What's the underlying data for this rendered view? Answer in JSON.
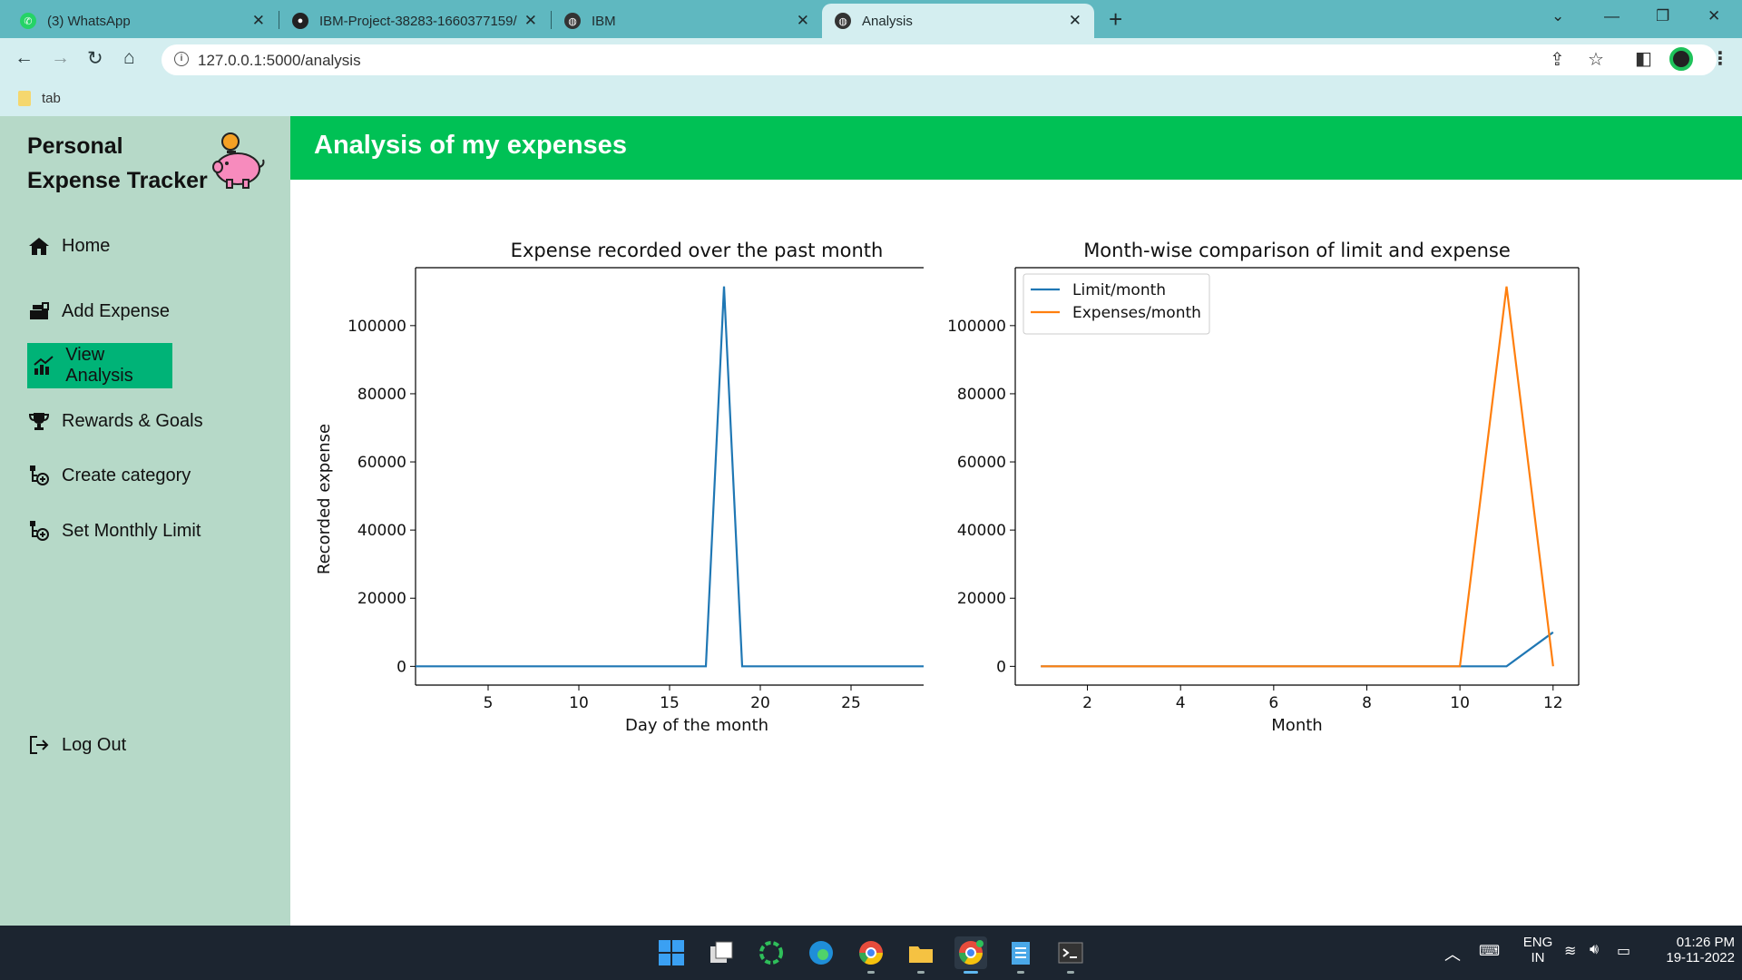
{
  "browser": {
    "tabs": [
      {
        "title": "(3) WhatsApp",
        "icon": "whatsapp-icon",
        "active": false
      },
      {
        "title": "IBM-Project-38283-1660377159/",
        "icon": "github-icon",
        "active": false
      },
      {
        "title": "IBM",
        "icon": "globe-icon",
        "active": false
      },
      {
        "title": "Analysis",
        "icon": "globe-icon",
        "active": true
      }
    ],
    "url": "127.0.0.1:5000/analysis",
    "bookmarks": [
      {
        "label": "tab"
      }
    ]
  },
  "sidebar": {
    "brand_line1": "Personal",
    "brand_line2": "Expense Tracker",
    "items": [
      {
        "label": "Home",
        "icon": "home-icon"
      },
      {
        "label": "Add Expense",
        "icon": "cash-register-icon"
      },
      {
        "label": "View Analysis",
        "icon": "chart-icon",
        "active": true
      },
      {
        "label": "Rewards & Goals",
        "icon": "trophy-icon"
      },
      {
        "label": "Create category",
        "icon": "category-add-icon"
      },
      {
        "label": "Set Monthly Limit",
        "icon": "category-add-icon"
      }
    ],
    "logout_label": "Log Out"
  },
  "main": {
    "title": "Analysis of my expenses"
  },
  "chart_data": [
    {
      "type": "line",
      "title": "Expense recorded over the past month",
      "xlabel": "Day of the month",
      "ylabel": "Recorded expense",
      "xlim": [
        1,
        29
      ],
      "ylim": [
        -5500,
        117000
      ],
      "xticks": [
        5,
        10,
        15,
        20,
        25
      ],
      "yticks": [
        0,
        20000,
        40000,
        60000,
        80000,
        100000
      ],
      "grid": false,
      "series": [
        {
          "x": [
            1,
            2,
            3,
            4,
            5,
            6,
            7,
            8,
            9,
            10,
            11,
            12,
            13,
            14,
            15,
            16,
            17,
            18,
            19,
            20,
            21,
            22,
            23,
            24,
            25,
            26,
            27,
            28,
            29
          ],
          "y": [
            0,
            0,
            0,
            0,
            0,
            0,
            0,
            0,
            0,
            0,
            0,
            0,
            0,
            0,
            0,
            0,
            0,
            111500,
            0,
            0,
            0,
            0,
            0,
            0,
            0,
            0,
            0,
            0,
            0
          ],
          "color": "#1f77b4"
        }
      ]
    },
    {
      "type": "line",
      "title": "Month-wise comparison of limit and expense",
      "xlabel": "Month",
      "ylabel": "",
      "xlim": [
        0.45,
        12.55
      ],
      "ylim": [
        -5500,
        117000
      ],
      "xticks": [
        2,
        4,
        6,
        8,
        10,
        12
      ],
      "yticks": [
        0,
        20000,
        40000,
        60000,
        80000,
        100000
      ],
      "grid": false,
      "legend": "upper-left",
      "series": [
        {
          "name": "Limit/month",
          "x": [
            1,
            2,
            3,
            4,
            5,
            6,
            7,
            8,
            9,
            10,
            11,
            12
          ],
          "y": [
            0,
            0,
            0,
            0,
            0,
            0,
            0,
            0,
            0,
            0,
            0,
            10000
          ],
          "color": "#1f77b4"
        },
        {
          "name": "Expenses/month",
          "x": [
            1,
            2,
            3,
            4,
            5,
            6,
            7,
            8,
            9,
            10,
            11,
            12
          ],
          "y": [
            0,
            0,
            0,
            0,
            0,
            0,
            0,
            0,
            0,
            0,
            111500,
            0
          ],
          "color": "#ff7f0e"
        }
      ]
    }
  ],
  "taskbar": {
    "apps": [
      {
        "icon": "windows-start-icon"
      },
      {
        "icon": "task-view-icon"
      },
      {
        "icon": "loading-app-icon"
      },
      {
        "icon": "edge-icon"
      },
      {
        "icon": "chrome-icon"
      },
      {
        "icon": "file-explorer-icon"
      },
      {
        "icon": "chrome-profile-icon"
      },
      {
        "icon": "notepad-icon"
      },
      {
        "icon": "terminal-icon"
      }
    ],
    "lang_line1": "ENG",
    "lang_line2": "IN",
    "time": "01:26 PM",
    "date": "19-11-2022"
  }
}
